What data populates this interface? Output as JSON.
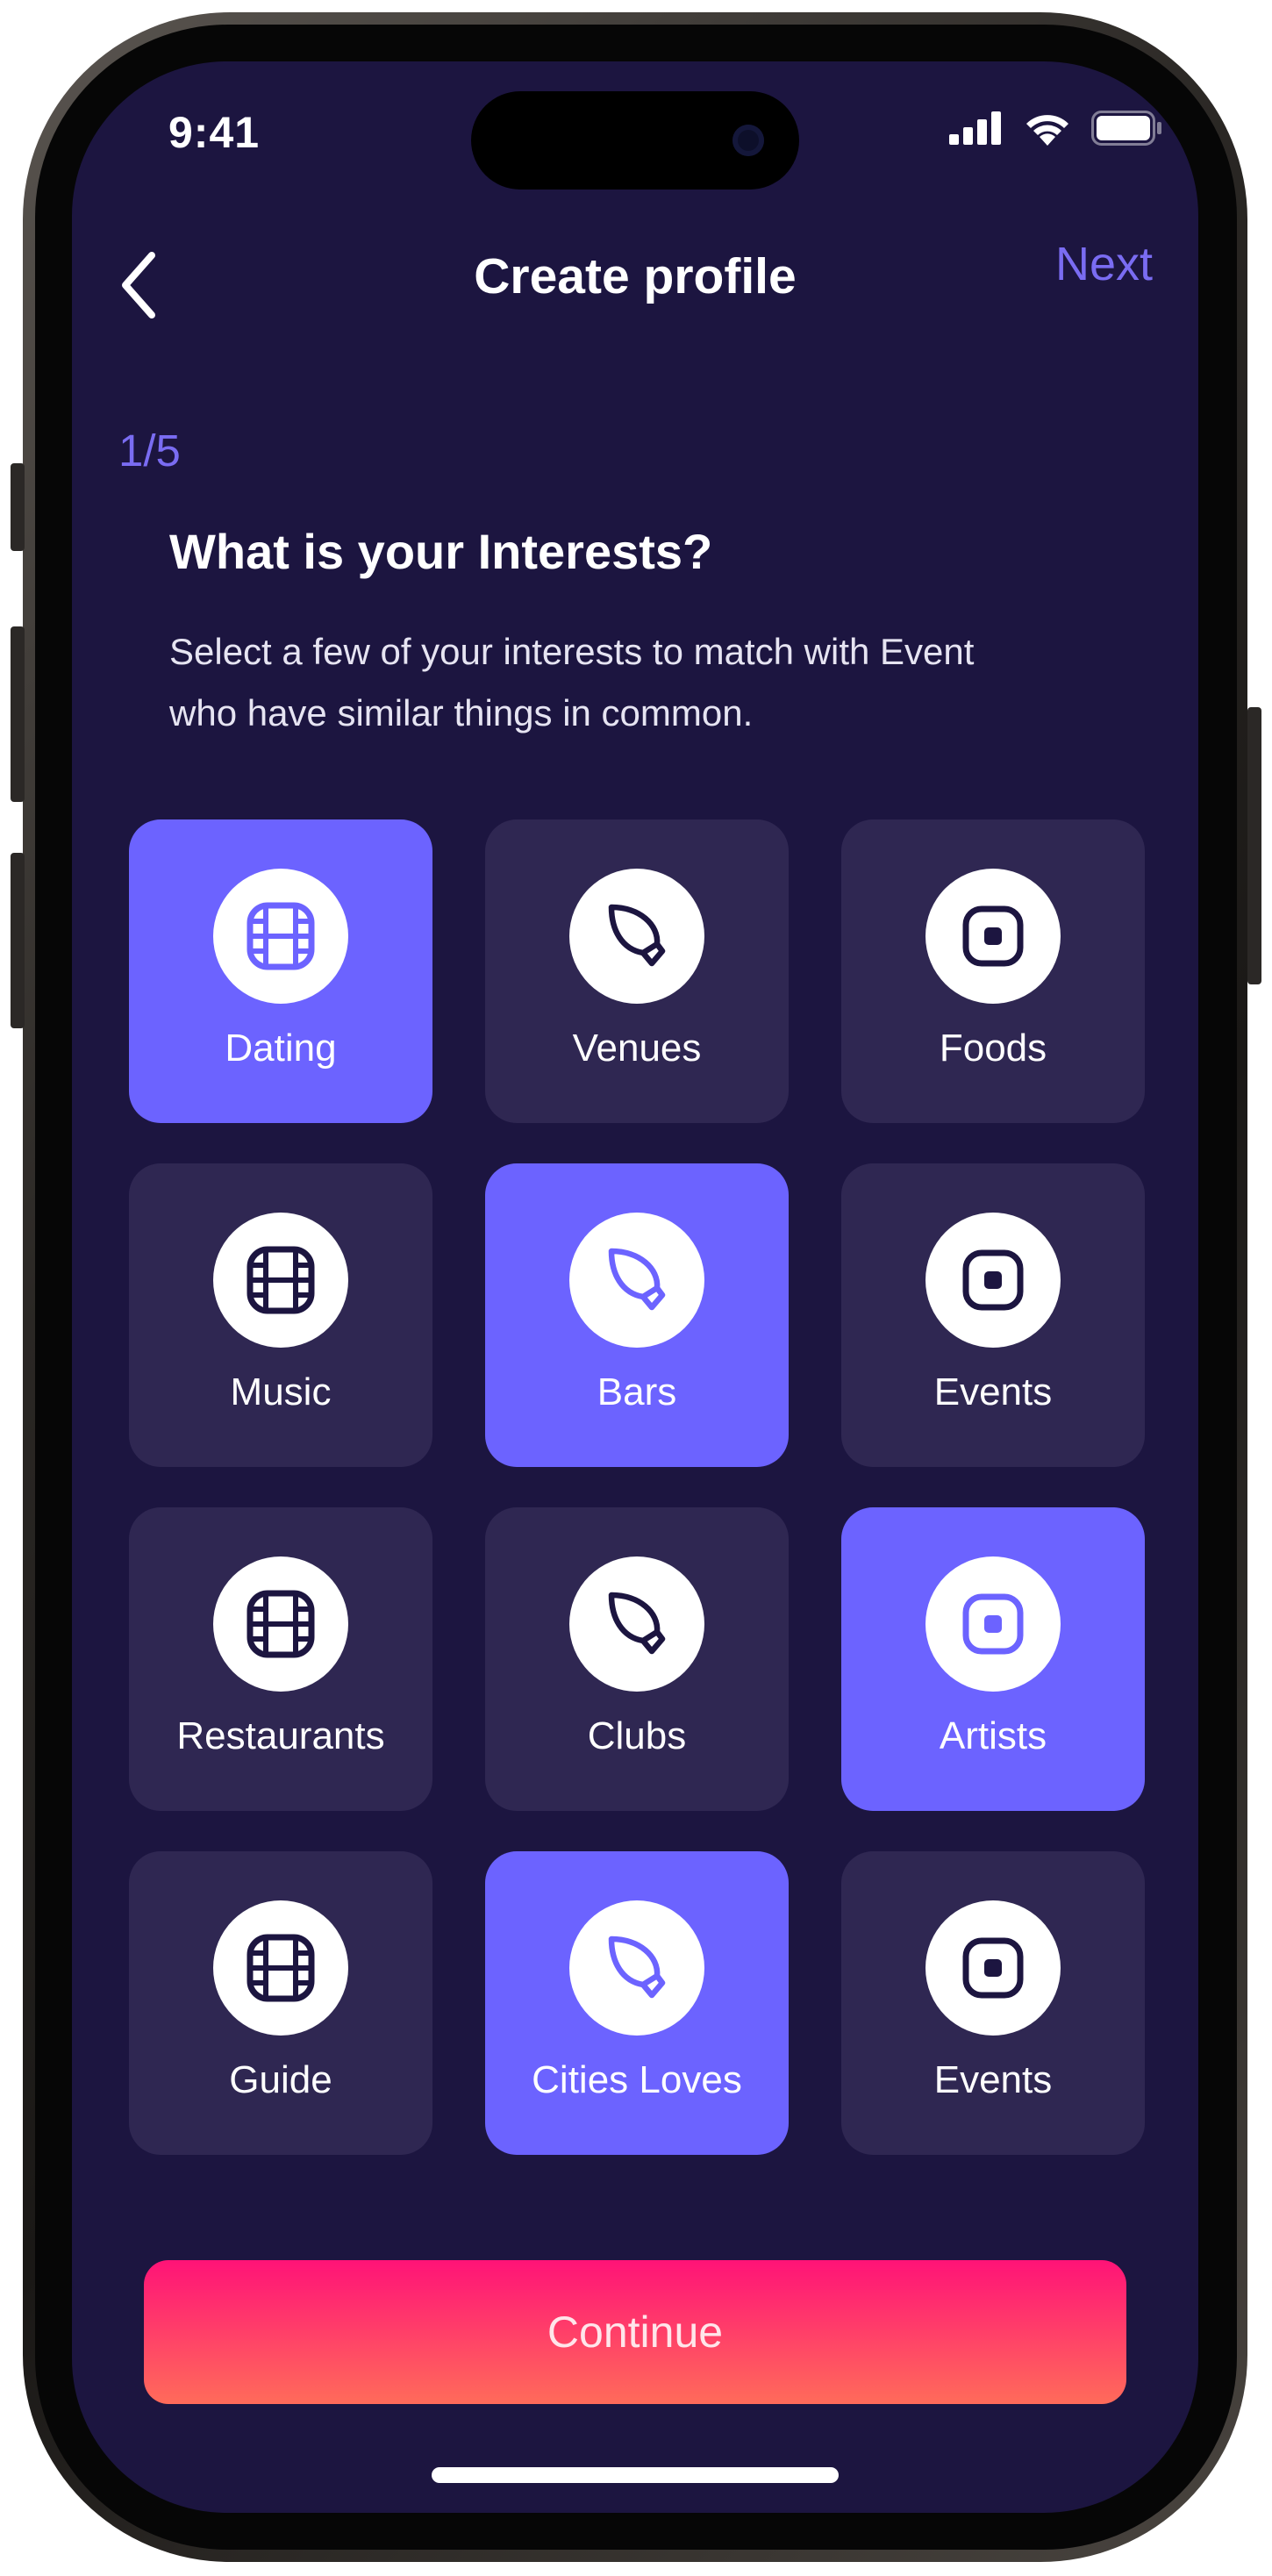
{
  "status_bar": {
    "time": "9:41"
  },
  "header": {
    "title": "Create profile",
    "next_label": "Next"
  },
  "step": "1/5",
  "question": {
    "title": "What is your Interests?",
    "subtitle": "Select a few of your interests to match with Event who have similar things in common."
  },
  "interests": [
    {
      "label": "Dating",
      "icon": "film-icon",
      "selected": true
    },
    {
      "label": "Venues",
      "icon": "leaf-icon",
      "selected": false
    },
    {
      "label": "Foods",
      "icon": "square-dot-icon",
      "selected": false
    },
    {
      "label": "Music",
      "icon": "film-icon",
      "selected": false
    },
    {
      "label": "Bars",
      "icon": "leaf-icon",
      "selected": true
    },
    {
      "label": "Events",
      "icon": "square-dot-icon",
      "selected": false
    },
    {
      "label": "Restaurants",
      "icon": "film-icon",
      "selected": false
    },
    {
      "label": "Clubs",
      "icon": "leaf-icon",
      "selected": false
    },
    {
      "label": "Artists",
      "icon": "square-dot-icon",
      "selected": true
    },
    {
      "label": "Guide",
      "icon": "film-icon",
      "selected": false
    },
    {
      "label": "Cities Loves",
      "icon": "leaf-icon",
      "selected": true
    },
    {
      "label": "Events",
      "icon": "square-dot-icon",
      "selected": false
    }
  ],
  "continue_label": "Continue",
  "colors": {
    "background": "#1c1540",
    "card": "#2f2752",
    "accent": "#6c63ff",
    "icon_dark": "#1c1540",
    "button_gradient_top": "#ff1377",
    "button_gradient_bottom": "#ff6b5a"
  }
}
